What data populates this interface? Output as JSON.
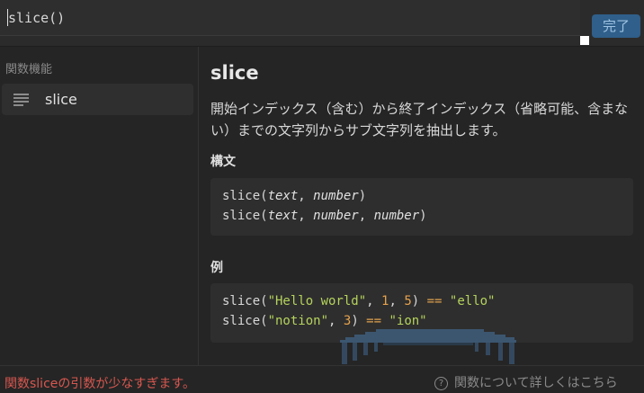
{
  "editor": {
    "value": "slice()",
    "done_label": "完了"
  },
  "sidebar": {
    "header": "関数機能",
    "items": [
      {
        "label": "slice",
        "icon": "list-icon"
      }
    ]
  },
  "detail": {
    "title": "slice",
    "description": "開始インデックス（含む）から終了インデックス（省略可能、含まない）までの文字列からサブ文字列を抽出します。",
    "syntax_label": "構文",
    "syntax": [
      {
        "fn": "slice(",
        "args": [
          "text",
          "number"
        ]
      },
      {
        "fn": "slice(",
        "args": [
          "text",
          "number",
          "number"
        ]
      }
    ],
    "example_label": "例",
    "examples": [
      {
        "fn": "slice(",
        "str": "\"Hello world\"",
        "n1": "1",
        "n2": "5",
        "op": "==",
        "result": "\"ello\""
      },
      {
        "fn": "slice(",
        "str": "\"notion\"",
        "n1": "3",
        "op": "==",
        "result": "\"ion\""
      }
    ]
  },
  "footer": {
    "error": "関数sliceの引数が少なすぎます。",
    "help_label": "関数について詳しくはこちら",
    "help_icon_glyph": "?"
  },
  "colors": {
    "error": "#d8574f",
    "done_button": "#2f5f8a",
    "string": "#b5d35c",
    "number": "#e6a24d"
  }
}
